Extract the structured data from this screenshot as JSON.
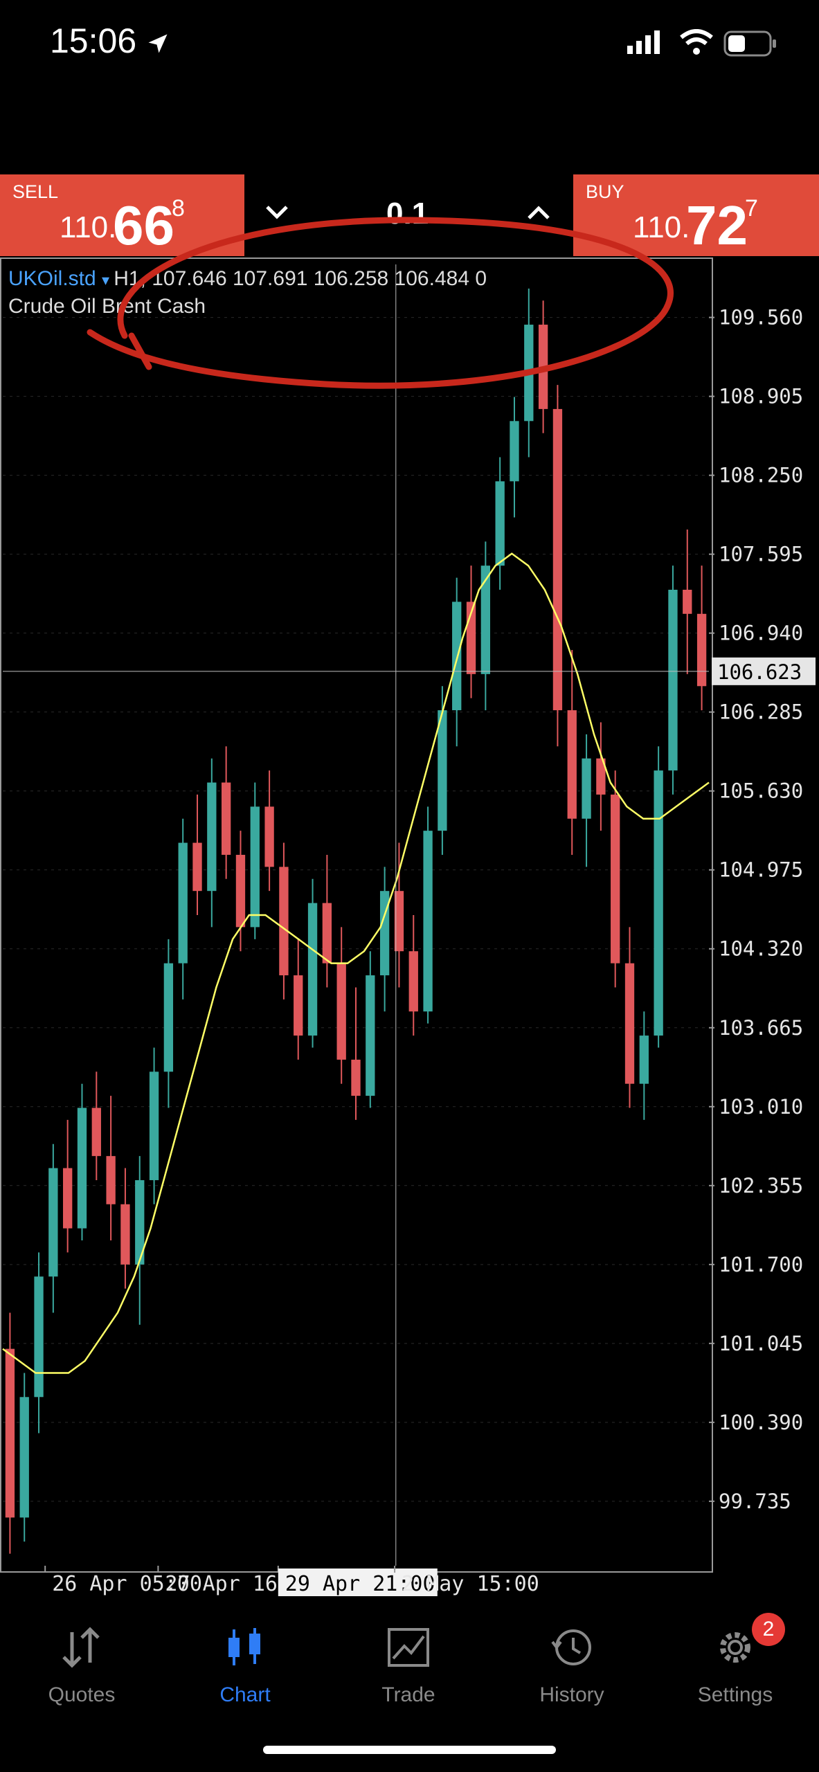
{
  "status_bar": {
    "time": "15:06",
    "icons": [
      "location-arrow-icon",
      "cellular-signal-icon",
      "wifi-icon",
      "battery-icon"
    ]
  },
  "toolbar": {
    "timeframe": "H1",
    "icons": [
      "crosshair-icon",
      "function-icon",
      "objects-icon",
      "history-clock-icon",
      "account-toggle-icon"
    ]
  },
  "trade_panel": {
    "sell_label": "SELL",
    "sell_price_prefix": "110.",
    "sell_price_big": "66",
    "sell_price_sup": "8",
    "buy_label": "BUY",
    "buy_price_prefix": "110.",
    "buy_price_big": "72",
    "buy_price_sup": "7",
    "volume": "0.1",
    "colors": {
      "panel": "#e04b3a"
    }
  },
  "chart_header": {
    "symbol": "UKOil.std",
    "ohlc": "H1, 107.646 107.691 106.258 106.484 0",
    "description": "Crude Oil Brent Cash"
  },
  "chart_data": {
    "type": "candlestick",
    "price_axis_ticks": [
      "109.560",
      "108.905",
      "108.250",
      "107.595",
      "106.940",
      "106.285",
      "105.630",
      "104.975",
      "104.320",
      "103.665",
      "103.010",
      "102.355",
      "101.700",
      "101.045",
      "100.390",
      "99.735"
    ],
    "crosshair_price": "106.623",
    "time_axis_ticks": [
      "26 Apr 05:00",
      "27 Apr 16:00",
      "29 Apr 21:00",
      "2 May 15:00"
    ],
    "crosshair_time": "29 Apr 21:00",
    "ylim": [
      99.2,
      110.0
    ],
    "colors": {
      "up": "#3aa99f",
      "down": "#e0585b",
      "ma": "#ffff66",
      "grid": "#2a2a2a"
    },
    "candles": [
      {
        "o": 101.0,
        "h": 101.3,
        "l": 99.3,
        "c": 99.6
      },
      {
        "o": 99.6,
        "h": 100.8,
        "l": 99.4,
        "c": 100.6
      },
      {
        "o": 100.6,
        "h": 101.8,
        "l": 100.3,
        "c": 101.6
      },
      {
        "o": 101.6,
        "h": 102.7,
        "l": 101.3,
        "c": 102.5
      },
      {
        "o": 102.5,
        "h": 102.9,
        "l": 101.8,
        "c": 102.0
      },
      {
        "o": 102.0,
        "h": 103.2,
        "l": 101.9,
        "c": 103.0
      },
      {
        "o": 103.0,
        "h": 103.3,
        "l": 102.4,
        "c": 102.6
      },
      {
        "o": 102.6,
        "h": 103.1,
        "l": 101.9,
        "c": 102.2
      },
      {
        "o": 102.2,
        "h": 102.5,
        "l": 101.5,
        "c": 101.7
      },
      {
        "o": 101.7,
        "h": 102.6,
        "l": 101.2,
        "c": 102.4
      },
      {
        "o": 102.4,
        "h": 103.5,
        "l": 102.2,
        "c": 103.3
      },
      {
        "o": 103.3,
        "h": 104.4,
        "l": 103.0,
        "c": 104.2
      },
      {
        "o": 104.2,
        "h": 105.4,
        "l": 103.9,
        "c": 105.2
      },
      {
        "o": 105.2,
        "h": 105.6,
        "l": 104.6,
        "c": 104.8
      },
      {
        "o": 104.8,
        "h": 105.9,
        "l": 104.5,
        "c": 105.7
      },
      {
        "o": 105.7,
        "h": 106.0,
        "l": 104.9,
        "c": 105.1
      },
      {
        "o": 105.1,
        "h": 105.3,
        "l": 104.3,
        "c": 104.5
      },
      {
        "o": 104.5,
        "h": 105.7,
        "l": 104.4,
        "c": 105.5
      },
      {
        "o": 105.5,
        "h": 105.8,
        "l": 104.8,
        "c": 105.0
      },
      {
        "o": 105.0,
        "h": 105.2,
        "l": 103.9,
        "c": 104.1
      },
      {
        "o": 104.1,
        "h": 104.4,
        "l": 103.4,
        "c": 103.6
      },
      {
        "o": 103.6,
        "h": 104.9,
        "l": 103.5,
        "c": 104.7
      },
      {
        "o": 104.7,
        "h": 105.1,
        "l": 104.0,
        "c": 104.2
      },
      {
        "o": 104.2,
        "h": 104.5,
        "l": 103.2,
        "c": 103.4
      },
      {
        "o": 103.4,
        "h": 104.0,
        "l": 102.9,
        "c": 103.1
      },
      {
        "o": 103.1,
        "h": 104.3,
        "l": 103.0,
        "c": 104.1
      },
      {
        "o": 104.1,
        "h": 105.0,
        "l": 103.8,
        "c": 104.8
      },
      {
        "o": 104.8,
        "h": 105.2,
        "l": 104.0,
        "c": 104.3
      },
      {
        "o": 104.3,
        "h": 104.6,
        "l": 103.6,
        "c": 103.8
      },
      {
        "o": 103.8,
        "h": 105.5,
        "l": 103.7,
        "c": 105.3
      },
      {
        "o": 105.3,
        "h": 106.5,
        "l": 105.1,
        "c": 106.3
      },
      {
        "o": 106.3,
        "h": 107.4,
        "l": 106.0,
        "c": 107.2
      },
      {
        "o": 107.2,
        "h": 107.5,
        "l": 106.4,
        "c": 106.6
      },
      {
        "o": 106.6,
        "h": 107.7,
        "l": 106.3,
        "c": 107.5
      },
      {
        "o": 107.5,
        "h": 108.4,
        "l": 107.3,
        "c": 108.2
      },
      {
        "o": 108.2,
        "h": 108.9,
        "l": 107.9,
        "c": 108.7
      },
      {
        "o": 108.7,
        "h": 109.8,
        "l": 108.4,
        "c": 109.5
      },
      {
        "o": 109.5,
        "h": 109.7,
        "l": 108.6,
        "c": 108.8
      },
      {
        "o": 108.8,
        "h": 109.0,
        "l": 106.0,
        "c": 106.3
      },
      {
        "o": 106.3,
        "h": 106.8,
        "l": 105.1,
        "c": 105.4
      },
      {
        "o": 105.4,
        "h": 106.1,
        "l": 105.0,
        "c": 105.9
      },
      {
        "o": 105.9,
        "h": 106.2,
        "l": 105.3,
        "c": 105.6
      },
      {
        "o": 105.6,
        "h": 105.8,
        "l": 104.0,
        "c": 104.2
      },
      {
        "o": 104.2,
        "h": 104.5,
        "l": 103.0,
        "c": 103.2
      },
      {
        "o": 103.2,
        "h": 103.8,
        "l": 102.9,
        "c": 103.6
      },
      {
        "o": 103.6,
        "h": 106.0,
        "l": 103.5,
        "c": 105.8
      },
      {
        "o": 105.8,
        "h": 107.5,
        "l": 105.6,
        "c": 107.3
      },
      {
        "o": 107.3,
        "h": 107.8,
        "l": 106.6,
        "c": 107.1
      },
      {
        "o": 107.1,
        "h": 107.5,
        "l": 106.3,
        "c": 106.5
      }
    ],
    "ma": [
      101.0,
      100.9,
      100.8,
      100.8,
      100.8,
      100.9,
      101.1,
      101.3,
      101.6,
      102.0,
      102.5,
      103.0,
      103.5,
      104.0,
      104.4,
      104.6,
      104.6,
      104.5,
      104.4,
      104.3,
      104.2,
      104.2,
      104.3,
      104.5,
      104.9,
      105.4,
      105.9,
      106.4,
      106.9,
      107.3,
      107.5,
      107.6,
      107.5,
      107.3,
      107.0,
      106.6,
      106.1,
      105.7,
      105.5,
      105.4,
      105.4,
      105.5,
      105.6,
      105.7
    ],
    "title": "",
    "xlabel": "",
    "ylabel": ""
  },
  "nav_bar": {
    "items": [
      {
        "label": "Quotes",
        "icon": "quotes-arrows-icon"
      },
      {
        "label": "Chart",
        "icon": "chart-candles-icon"
      },
      {
        "label": "Trade",
        "icon": "trade-chart-icon"
      },
      {
        "label": "History",
        "icon": "history-clock-icon"
      },
      {
        "label": "Settings",
        "icon": "settings-gear-icon"
      }
    ],
    "settings_badge": "2",
    "active_color": "#2f7df6"
  }
}
